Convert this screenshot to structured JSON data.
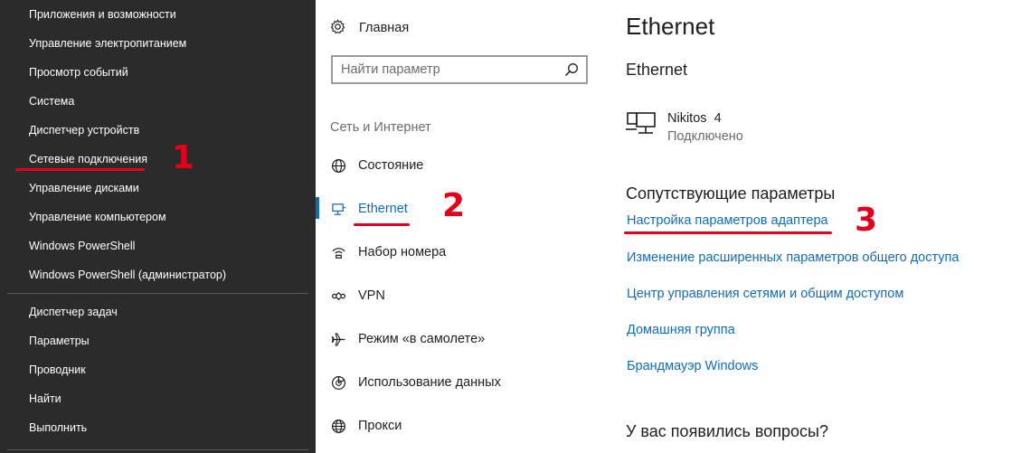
{
  "winx_menu": {
    "items_top": [
      "Приложения и возможности",
      "Управление электропитанием",
      "Просмотр событий",
      "Система",
      "Диспетчер устройств",
      "Сетевые подключения",
      "Управление дисками",
      "Управление компьютером",
      "Windows PowerShell",
      "Windows PowerShell (администратор)"
    ],
    "items_bottom": [
      "Диспетчер задач",
      "Параметры",
      "Проводник",
      "Найти",
      "Выполнить"
    ],
    "background_color": "#2b2b2b",
    "text_color": "#ffffff"
  },
  "settings_nav": {
    "home_label": "Главная",
    "home_icon": "gear-icon",
    "search_placeholder": "Найти параметр",
    "search_value": "",
    "search_icon": "search-icon",
    "section_label": "Сеть и Интернет",
    "items": [
      {
        "label": "Состояние",
        "icon": "globe-icon"
      },
      {
        "label": "Ethernet",
        "icon": "ethernet-icon",
        "active": true
      },
      {
        "label": "Набор номера",
        "icon": "dialup-icon"
      },
      {
        "label": "VPN",
        "icon": "vpn-icon"
      },
      {
        "label": "Режим «в самолете»",
        "icon": "airplane-icon"
      },
      {
        "label": "Использование данных",
        "icon": "data-usage-icon"
      },
      {
        "label": "Прокси",
        "icon": "proxy-globe-icon"
      }
    ]
  },
  "content": {
    "title": "Ethernet",
    "subtitle": "Ethernet",
    "device": {
      "name": "Nikitos  4",
      "status": "Подключено",
      "icon": "network-computer-icon"
    },
    "related_title": "Сопутствующие параметры",
    "links": [
      "Настройка параметров адаптера",
      "Изменение расширенных параметров общего доступа",
      "Центр управления сетями и общим доступом",
      "Домашняя группа",
      "Брандмауэр Windows"
    ],
    "questions_title": "У вас появились вопросы?"
  },
  "annotations": {
    "numbers": [
      "1",
      "2",
      "3"
    ],
    "color": "#e4001b"
  },
  "colors": {
    "accent": "#0f6cbd",
    "text": "#1e1e1e",
    "secondary_text": "#6b6b6b"
  }
}
